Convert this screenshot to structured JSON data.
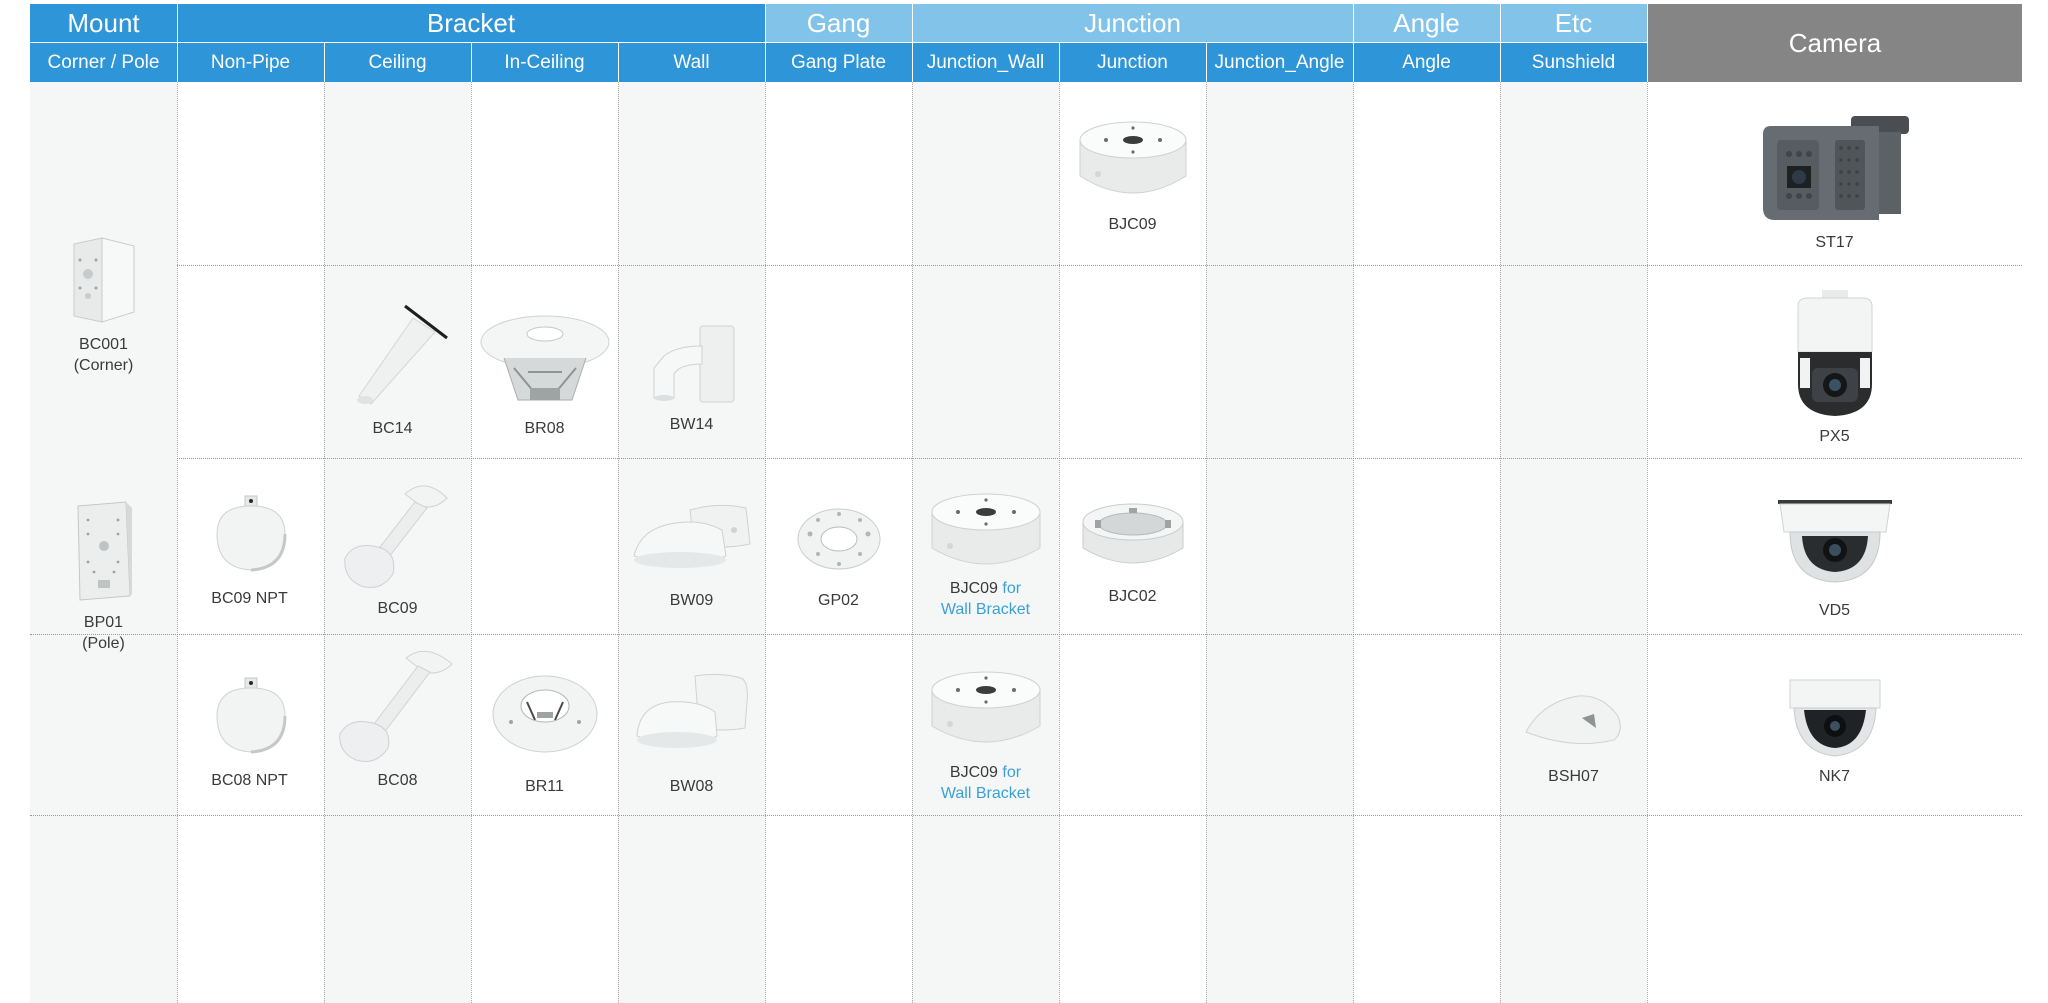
{
  "header": {
    "groups": {
      "mount": "Mount",
      "bracket": "Bracket",
      "gang": "Gang",
      "junction": "Junction",
      "angle": "Angle",
      "etc": "Etc",
      "camera": "Camera"
    },
    "columns": {
      "corner_pole": "Corner / Pole",
      "non_pipe": "Non-Pipe",
      "ceiling": "Ceiling",
      "in_ceiling": "In-Ceiling",
      "wall": "Wall",
      "gang_plate": "Gang Plate",
      "junction_wall": "Junction_Wall",
      "junction": "Junction",
      "junction_angle": "Junction_Angle",
      "angle": "Angle",
      "sunshield": "Sunshield"
    }
  },
  "mounts": {
    "bc001": {
      "name": "BC001",
      "sub": "(Corner)"
    },
    "bp01": {
      "name": "BP01",
      "sub": "(Pole)"
    }
  },
  "row1": {
    "junction": "BJC09",
    "camera": "ST17"
  },
  "row2": {
    "ceiling": "BC14",
    "in_ceiling": "BR08",
    "wall": "BW14",
    "camera": "PX5"
  },
  "row3": {
    "non_pipe": "BC09 NPT",
    "ceiling": "BC09",
    "wall": "BW09",
    "gang_plate": "GP02",
    "junction_wall": "BJC09",
    "junction_wall_note1": "for",
    "junction_wall_note2": "Wall Bracket",
    "junction": "BJC02",
    "camera": "VD5"
  },
  "row4": {
    "non_pipe": "BC08 NPT",
    "ceiling": "BC08",
    "in_ceiling": "BR11",
    "wall": "BW08",
    "junction_wall": "BJC09",
    "junction_wall_note1": "for",
    "junction_wall_note2": "Wall Bracket",
    "sunshield": "BSH07",
    "camera": "NK7"
  },
  "colors": {
    "header_dark": "#2e95d9",
    "header_light": "#82c3e9",
    "camera_header": "#858585",
    "note_text": "#3aa0d8",
    "shaded_column": "#f5f7f7"
  }
}
